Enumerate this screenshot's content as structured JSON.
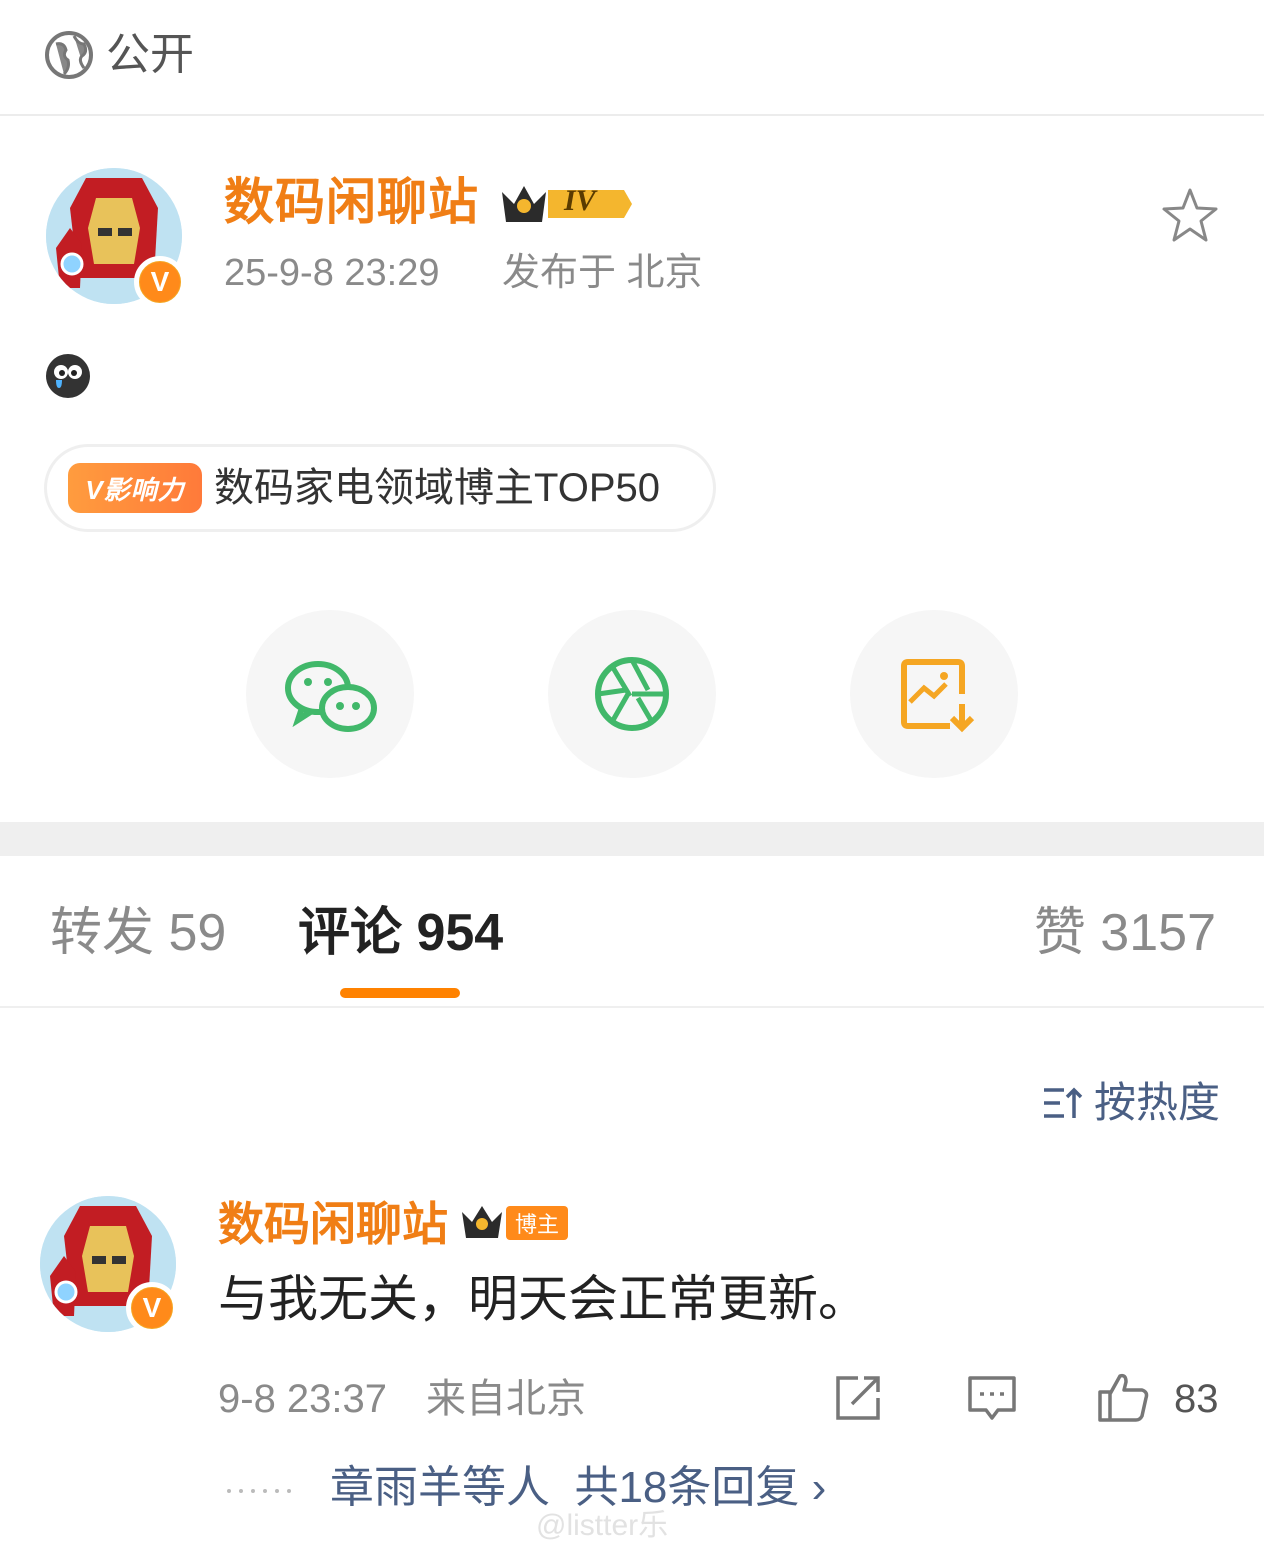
{
  "visibility": {
    "icon": "globe-icon",
    "label": "公开"
  },
  "post": {
    "author": "数码闲聊站",
    "rank_badge": "IV",
    "time": "25-9-8 23:29",
    "location": "发布于 北京",
    "emoji": "crying-face-emoji",
    "influence": {
      "tag": "V影响力",
      "text": "数码家电领域博主TOP50"
    }
  },
  "share": [
    {
      "icon": "wechat-icon"
    },
    {
      "icon": "moments-icon"
    },
    {
      "icon": "save-image-icon"
    }
  ],
  "tabs": {
    "repost": "转发 59",
    "comment": "评论 954",
    "like": "赞 3157"
  },
  "sort_label": "按热度",
  "comment": {
    "author": "数码闲聊站",
    "tag": "博主",
    "text": "与我无关，明天会正常更新。",
    "time": "9-8 23:37",
    "from": "来自北京",
    "likes": "83",
    "replies_label": "章雨羊等人  共18条回复 ›"
  },
  "watermark": "@listter乐",
  "colors": {
    "accent": "#ff8200",
    "name": "#f07e15",
    "link": "#4a5f84"
  }
}
